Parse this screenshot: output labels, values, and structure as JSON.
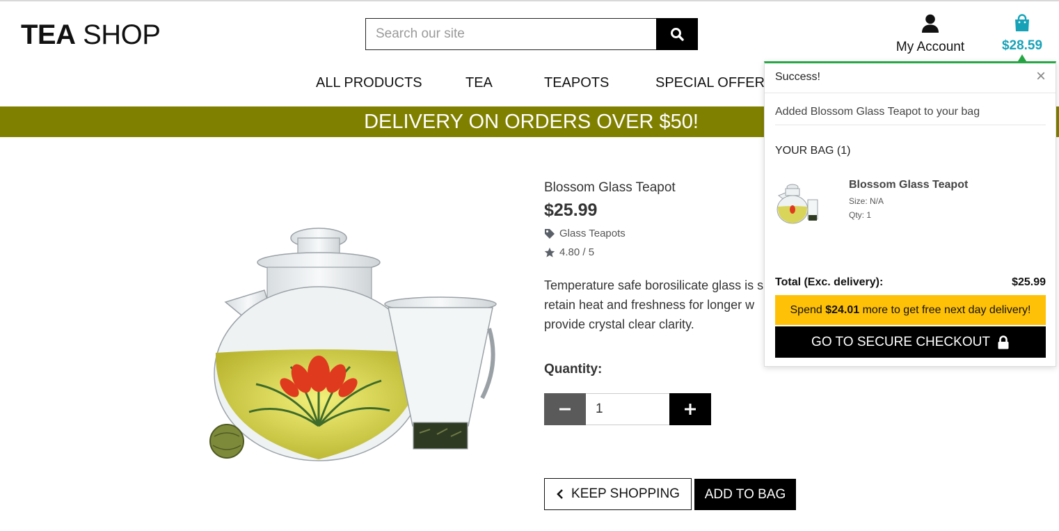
{
  "header": {
    "logo_bold": "TEA",
    "logo_light": " SHOP",
    "search_placeholder": "Search our site",
    "account_label": "My Account",
    "bag_total": "$28.59"
  },
  "nav": {
    "items": [
      "ALL PRODUCTS",
      "TEA",
      "TEAPOTS",
      "SPECIAL OFFERS"
    ]
  },
  "banner": {
    "text": "DELIVERY ON ORDERS OVER $50!"
  },
  "product": {
    "name": "Blossom Glass Teapot",
    "price": "$25.99",
    "category": "Glass Teapots",
    "rating": "4.80 / 5",
    "description": "Temperature safe borosilicate glass is s retain heat and freshness for longer w provide crystal clear clarity.",
    "description_lines": [
      "Temperature safe borosilicate glass is s",
      "retain heat and freshness for longer w",
      "provide crystal clear clarity."
    ],
    "quantity_label": "Quantity:",
    "quantity_value": "1",
    "keep_shopping_label": "KEEP SHOPPING",
    "add_to_bag_label": "ADD TO BAG"
  },
  "toast": {
    "title": "Success!",
    "close": "×",
    "message": "Added Blossom Glass Teapot to your bag",
    "bag_heading": "YOUR BAG (1)",
    "item": {
      "name": "Blossom Glass Teapot",
      "size": "Size: N/A",
      "qty": "Qty: 1"
    },
    "total_label": "Total (Exc. delivery):",
    "total_value": "$25.99",
    "spend_prefix": "Spend ",
    "spend_amount": "$24.01",
    "spend_suffix": " more to get free next day delivery!",
    "checkout_label": "GO TO SECURE CHECKOUT"
  },
  "colors": {
    "banner": "#808000",
    "accent": "#17a2b8",
    "success": "#28a745",
    "warning": "#ffc107"
  },
  "icons": [
    "search-icon",
    "user-icon",
    "shopping-bag-icon",
    "tag-icon",
    "star-icon",
    "minus-icon",
    "plus-icon",
    "chevron-left-icon",
    "close-icon",
    "lock-icon"
  ]
}
